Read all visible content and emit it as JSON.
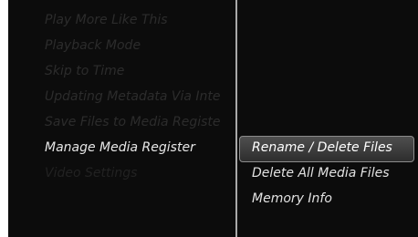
{
  "left_menu": {
    "items": [
      {
        "label": "Play More Like This"
      },
      {
        "label": "Playback Mode"
      },
      {
        "label": "Skip to Time"
      },
      {
        "label": "Updating Metadata Via Inte"
      },
      {
        "label": "Save Files to Media Registe"
      },
      {
        "label": "Manage Media Register"
      },
      {
        "label": "Video Settings"
      }
    ]
  },
  "submenu": {
    "items": [
      {
        "label": "Rename / Delete Files"
      },
      {
        "label": "Delete All Media Files"
      },
      {
        "label": "Memory Info"
      }
    ]
  }
}
